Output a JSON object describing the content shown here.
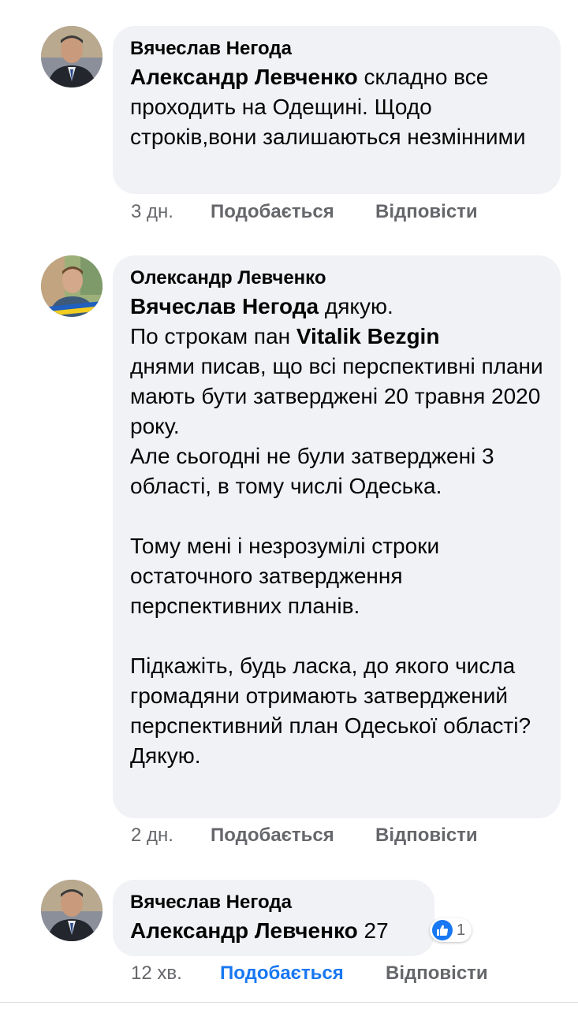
{
  "comments": [
    {
      "author": "Вячеслав Негода",
      "mention": "Александр Левченко",
      "text": " складно все проходить на Одещині. Щодо строків,вони залишаються незмінними",
      "time": "3 дн.",
      "like_label": "Подобається",
      "reply_label": "Відповісти"
    },
    {
      "author": "Олександр Левченко",
      "mention": "Вячеслав Негода",
      "text_part1": " дякую.\nПо строкам пан ",
      "mention2": "Vitalik Bezgin",
      "text_part2": "\nднями писав, що всі перспективні плани мають бути затверджені 20 травня 2020 року.\nАле сьогодні не були затверджені 3 області, в тому числі Одеська.\n\nТому мені і незрозумілі строки остаточного затвердження перспективних планів.\n\nПідкажіть, будь ласка, до якого числа громадяни отримають затверджений перспективний план Одеської області?\nДякую.",
      "time": "2 дн.",
      "like_label": "Подобається",
      "reply_label": "Відповісти"
    },
    {
      "author": "Вячеслав Негода",
      "mention": "Александр Левченко",
      "text": " 27",
      "time": "12 хв.",
      "like_label": "Подобається",
      "reply_label": "Відповісти",
      "reaction_icon": "like-icon",
      "reaction_count": "1",
      "liked": true
    }
  ],
  "colors": {
    "bubble": "#f0f2f5",
    "meta": "#65676b",
    "accent": "#1877f2"
  }
}
